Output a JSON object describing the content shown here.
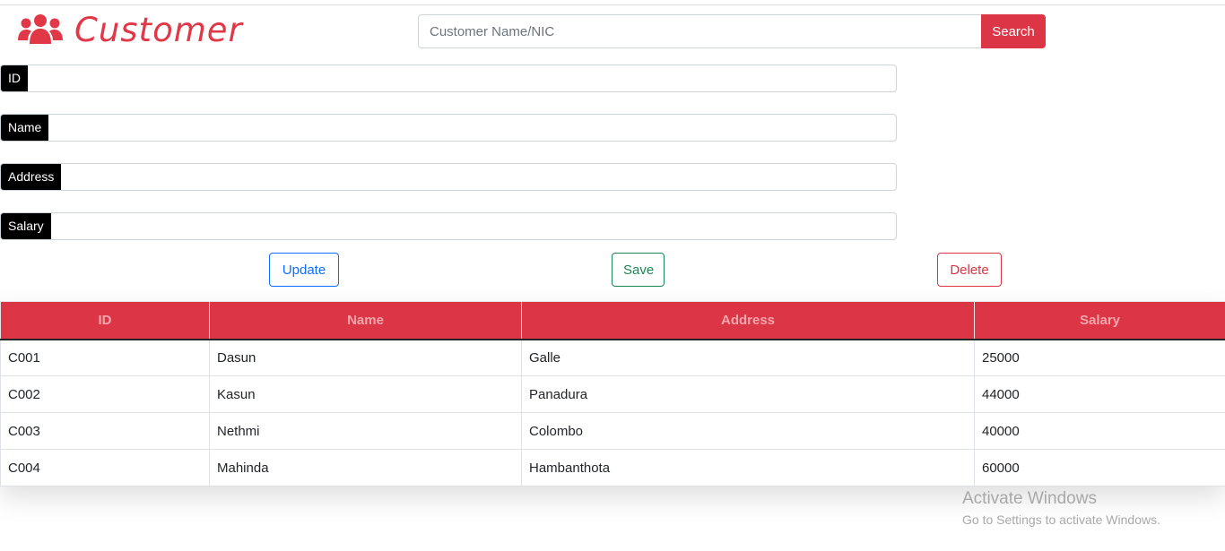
{
  "header": {
    "title": "Customer",
    "icon": "users-icon",
    "accent": "#e03847"
  },
  "search": {
    "placeholder": "Customer Name/NIC",
    "value": "",
    "button_label": "Search"
  },
  "form": {
    "fields": [
      {
        "label": "ID",
        "value": ""
      },
      {
        "label": "Name",
        "value": ""
      },
      {
        "label": "Address",
        "value": ""
      },
      {
        "label": "Salary",
        "value": ""
      }
    ]
  },
  "actions": {
    "update_label": "Update",
    "save_label": "Save",
    "delete_label": "Delete"
  },
  "table": {
    "headers": [
      "ID",
      "Name",
      "Address",
      "Salary"
    ],
    "rows": [
      [
        "C001",
        "Dasun",
        "Galle",
        "25000"
      ],
      [
        "C002",
        "Kasun",
        "Panadura",
        "44000"
      ],
      [
        "C003",
        "Nethmi",
        "Colombo",
        "40000"
      ],
      [
        "C004",
        "Mahinda",
        "Hambanthota",
        "60000"
      ]
    ]
  },
  "watermark": {
    "line1": "Activate Windows",
    "line2": "Go to Settings to activate Windows."
  },
  "colors": {
    "danger": "#dc3545",
    "primary": "#0d6efd",
    "success": "#198754"
  }
}
